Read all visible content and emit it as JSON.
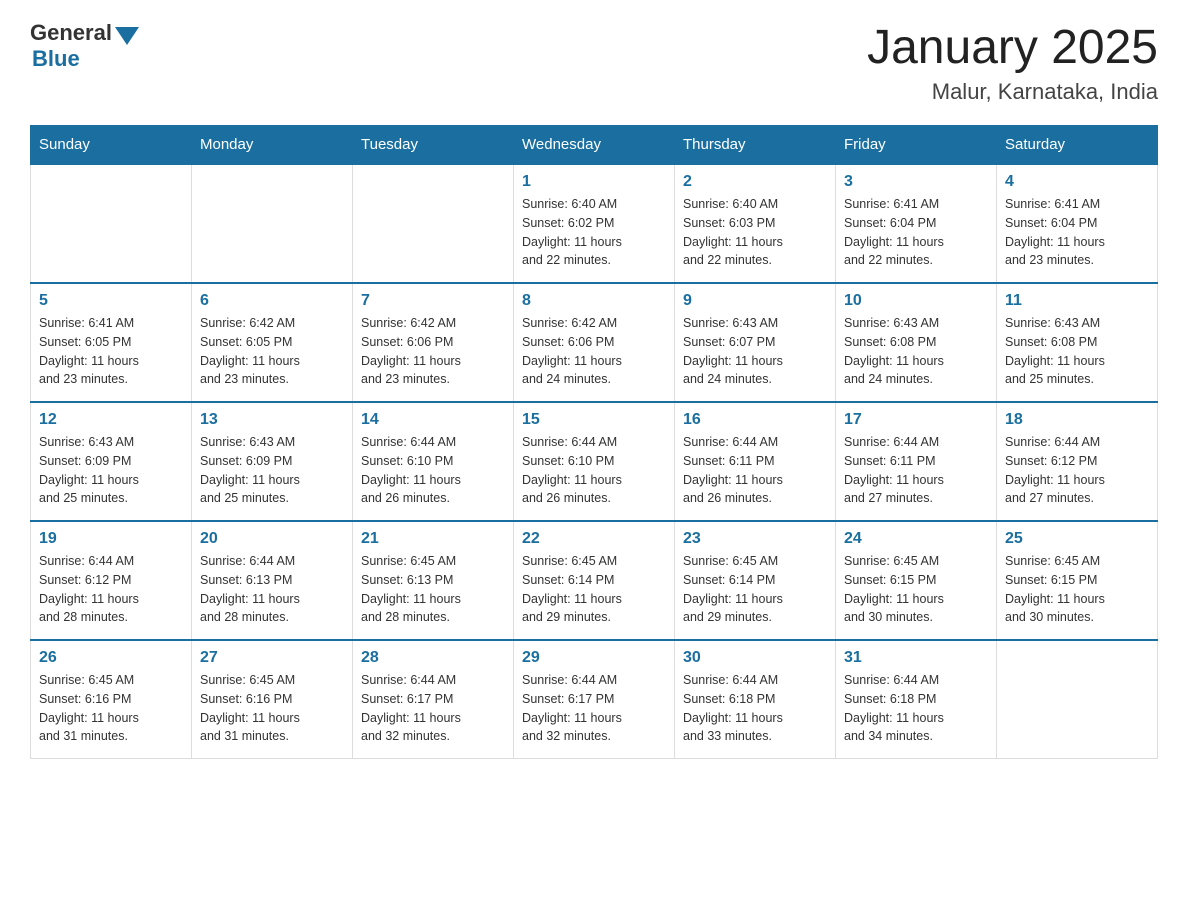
{
  "header": {
    "logo_general": "General",
    "logo_blue": "Blue",
    "month_year": "January 2025",
    "location": "Malur, Karnataka, India"
  },
  "days_of_week": [
    "Sunday",
    "Monday",
    "Tuesday",
    "Wednesday",
    "Thursday",
    "Friday",
    "Saturday"
  ],
  "weeks": [
    [
      {
        "day": "",
        "info": ""
      },
      {
        "day": "",
        "info": ""
      },
      {
        "day": "",
        "info": ""
      },
      {
        "day": "1",
        "info": "Sunrise: 6:40 AM\nSunset: 6:02 PM\nDaylight: 11 hours\nand 22 minutes."
      },
      {
        "day": "2",
        "info": "Sunrise: 6:40 AM\nSunset: 6:03 PM\nDaylight: 11 hours\nand 22 minutes."
      },
      {
        "day": "3",
        "info": "Sunrise: 6:41 AM\nSunset: 6:04 PM\nDaylight: 11 hours\nand 22 minutes."
      },
      {
        "day": "4",
        "info": "Sunrise: 6:41 AM\nSunset: 6:04 PM\nDaylight: 11 hours\nand 23 minutes."
      }
    ],
    [
      {
        "day": "5",
        "info": "Sunrise: 6:41 AM\nSunset: 6:05 PM\nDaylight: 11 hours\nand 23 minutes."
      },
      {
        "day": "6",
        "info": "Sunrise: 6:42 AM\nSunset: 6:05 PM\nDaylight: 11 hours\nand 23 minutes."
      },
      {
        "day": "7",
        "info": "Sunrise: 6:42 AM\nSunset: 6:06 PM\nDaylight: 11 hours\nand 23 minutes."
      },
      {
        "day": "8",
        "info": "Sunrise: 6:42 AM\nSunset: 6:06 PM\nDaylight: 11 hours\nand 24 minutes."
      },
      {
        "day": "9",
        "info": "Sunrise: 6:43 AM\nSunset: 6:07 PM\nDaylight: 11 hours\nand 24 minutes."
      },
      {
        "day": "10",
        "info": "Sunrise: 6:43 AM\nSunset: 6:08 PM\nDaylight: 11 hours\nand 24 minutes."
      },
      {
        "day": "11",
        "info": "Sunrise: 6:43 AM\nSunset: 6:08 PM\nDaylight: 11 hours\nand 25 minutes."
      }
    ],
    [
      {
        "day": "12",
        "info": "Sunrise: 6:43 AM\nSunset: 6:09 PM\nDaylight: 11 hours\nand 25 minutes."
      },
      {
        "day": "13",
        "info": "Sunrise: 6:43 AM\nSunset: 6:09 PM\nDaylight: 11 hours\nand 25 minutes."
      },
      {
        "day": "14",
        "info": "Sunrise: 6:44 AM\nSunset: 6:10 PM\nDaylight: 11 hours\nand 26 minutes."
      },
      {
        "day": "15",
        "info": "Sunrise: 6:44 AM\nSunset: 6:10 PM\nDaylight: 11 hours\nand 26 minutes."
      },
      {
        "day": "16",
        "info": "Sunrise: 6:44 AM\nSunset: 6:11 PM\nDaylight: 11 hours\nand 26 minutes."
      },
      {
        "day": "17",
        "info": "Sunrise: 6:44 AM\nSunset: 6:11 PM\nDaylight: 11 hours\nand 27 minutes."
      },
      {
        "day": "18",
        "info": "Sunrise: 6:44 AM\nSunset: 6:12 PM\nDaylight: 11 hours\nand 27 minutes."
      }
    ],
    [
      {
        "day": "19",
        "info": "Sunrise: 6:44 AM\nSunset: 6:12 PM\nDaylight: 11 hours\nand 28 minutes."
      },
      {
        "day": "20",
        "info": "Sunrise: 6:44 AM\nSunset: 6:13 PM\nDaylight: 11 hours\nand 28 minutes."
      },
      {
        "day": "21",
        "info": "Sunrise: 6:45 AM\nSunset: 6:13 PM\nDaylight: 11 hours\nand 28 minutes."
      },
      {
        "day": "22",
        "info": "Sunrise: 6:45 AM\nSunset: 6:14 PM\nDaylight: 11 hours\nand 29 minutes."
      },
      {
        "day": "23",
        "info": "Sunrise: 6:45 AM\nSunset: 6:14 PM\nDaylight: 11 hours\nand 29 minutes."
      },
      {
        "day": "24",
        "info": "Sunrise: 6:45 AM\nSunset: 6:15 PM\nDaylight: 11 hours\nand 30 minutes."
      },
      {
        "day": "25",
        "info": "Sunrise: 6:45 AM\nSunset: 6:15 PM\nDaylight: 11 hours\nand 30 minutes."
      }
    ],
    [
      {
        "day": "26",
        "info": "Sunrise: 6:45 AM\nSunset: 6:16 PM\nDaylight: 11 hours\nand 31 minutes."
      },
      {
        "day": "27",
        "info": "Sunrise: 6:45 AM\nSunset: 6:16 PM\nDaylight: 11 hours\nand 31 minutes."
      },
      {
        "day": "28",
        "info": "Sunrise: 6:44 AM\nSunset: 6:17 PM\nDaylight: 11 hours\nand 32 minutes."
      },
      {
        "day": "29",
        "info": "Sunrise: 6:44 AM\nSunset: 6:17 PM\nDaylight: 11 hours\nand 32 minutes."
      },
      {
        "day": "30",
        "info": "Sunrise: 6:44 AM\nSunset: 6:18 PM\nDaylight: 11 hours\nand 33 minutes."
      },
      {
        "day": "31",
        "info": "Sunrise: 6:44 AM\nSunset: 6:18 PM\nDaylight: 11 hours\nand 34 minutes."
      },
      {
        "day": "",
        "info": ""
      }
    ]
  ]
}
